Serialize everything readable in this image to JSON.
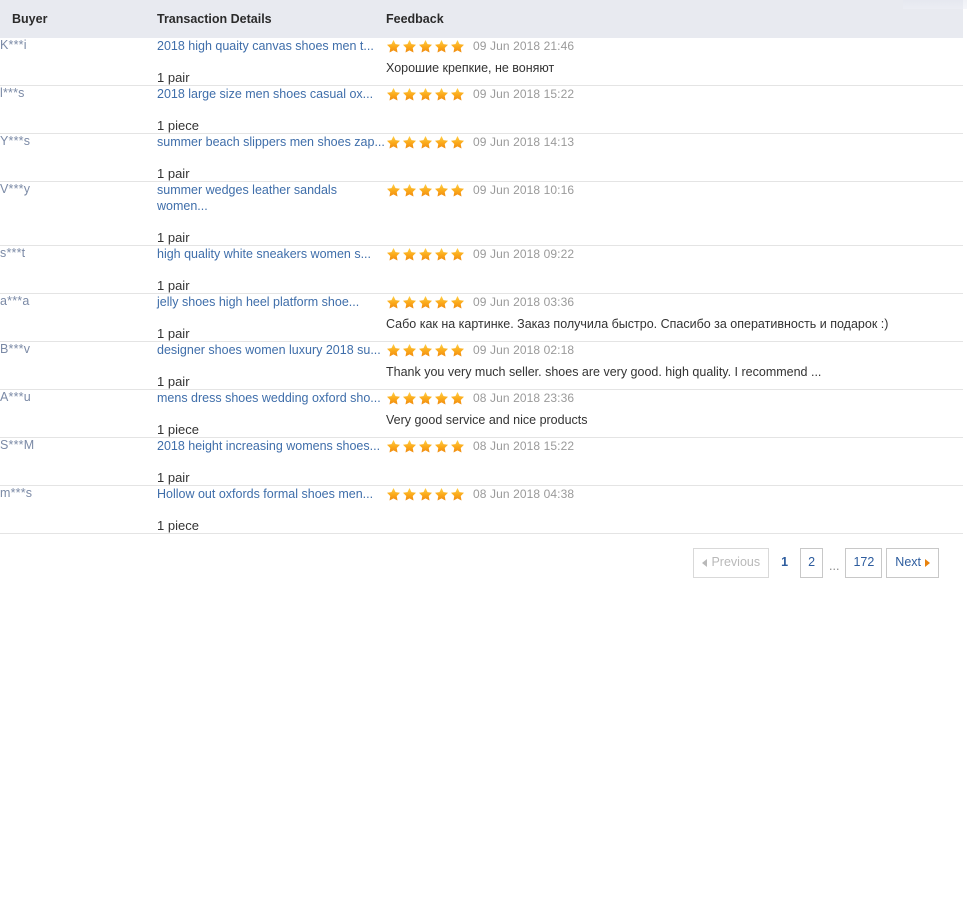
{
  "table": {
    "columns": [
      {
        "key": "buyer",
        "label": "Buyer"
      },
      {
        "key": "details",
        "label": "Transaction Details"
      },
      {
        "key": "feedback",
        "label": "Feedback"
      }
    ],
    "rows": [
      {
        "buyer": "K***i",
        "product": "2018 high quaity canvas shoes men t...",
        "quantity": "1 pair",
        "rating": 5,
        "date": "09 Jun 2018 21:46",
        "comment": "Хорошие крепкие, не воняют"
      },
      {
        "buyer": "l***s",
        "product": "2018 large size men shoes casual ox...",
        "quantity": "1 piece",
        "rating": 5,
        "date": "09 Jun 2018 15:22",
        "comment": ""
      },
      {
        "buyer": "Y***s",
        "product": "summer beach slippers men shoes zap...",
        "quantity": "1 pair",
        "rating": 5,
        "date": "09 Jun 2018 14:13",
        "comment": ""
      },
      {
        "buyer": "V***y",
        "product": "summer wedges leather sandals women...",
        "quantity": "1 pair",
        "rating": 5,
        "date": "09 Jun 2018 10:16",
        "comment": ""
      },
      {
        "buyer": "s***t",
        "product": "high quality white sneakers women s...",
        "quantity": "1 pair",
        "rating": 5,
        "date": "09 Jun 2018 09:22",
        "comment": ""
      },
      {
        "buyer": "a***a",
        "product": "jelly shoes high heel platform shoe...",
        "quantity": "1 pair",
        "rating": 5,
        "date": "09 Jun 2018 03:36",
        "comment": "Сабо как на картинке. Заказ получила быстро. Спасибо за оперативность и подарок :)"
      },
      {
        "buyer": "B***v",
        "product": "designer shoes women luxury 2018 su...",
        "quantity": "1 pair",
        "rating": 5,
        "date": "09 Jun 2018 02:18",
        "comment": "Thank you very much seller. shoes are very good. high quality. I recommend ..."
      },
      {
        "buyer": "A***u",
        "product": "mens dress shoes wedding oxford sho...",
        "quantity": "1 piece",
        "rating": 5,
        "date": "08 Jun 2018 23:36",
        "comment": "Very good service and nice products"
      },
      {
        "buyer": "S***M",
        "product": "2018 height increasing womens shoes...",
        "quantity": "1 pair",
        "rating": 5,
        "date": "08 Jun 2018 15:22",
        "comment": ""
      },
      {
        "buyer": "m***s",
        "product": "Hollow out oxfords formal shoes men...",
        "quantity": "1 piece",
        "rating": 5,
        "date": "08 Jun 2018 04:38",
        "comment": ""
      }
    ]
  },
  "pagination": {
    "previous_label": "Previous",
    "next_label": "Next",
    "ellipsis": "...",
    "current_page": "1",
    "pages": [
      "1",
      "2"
    ],
    "last_page": "172",
    "previous_disabled": true
  },
  "colors": {
    "header_bg": "#e8eaf0",
    "link": "#3f6eaa",
    "buyer": "#7b8aa6",
    "date": "#9a9a9a",
    "star": "#f5a623",
    "divider": "#e4e4e4"
  }
}
